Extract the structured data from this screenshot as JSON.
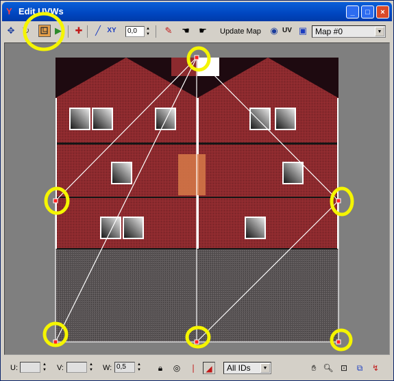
{
  "window": {
    "title": "Edit UVWs"
  },
  "title_buttons": {
    "minimize": "_",
    "maximize": "□",
    "close": "×"
  },
  "toolbar": {
    "icons": [
      "move-icon",
      "freeform-icon",
      "mirror-icon",
      "plus-icon",
      "line-icon",
      "xy-icon"
    ],
    "xy_label": "XY",
    "spinner_value": "0,0",
    "update_map_label": "Update Map",
    "uv_label": "UV",
    "map_select": "Map #0"
  },
  "bottom": {
    "u_label": "U:",
    "u_value": "",
    "v_label": "V:",
    "v_value": "",
    "w_label": "W:",
    "w_value": "0,5",
    "ids_select": "All IDs"
  },
  "colors": {
    "brick": "#8c2a2e",
    "roof_dark": "#1e0a10",
    "foundation": "#5a5556",
    "door": "#d67a48",
    "highlight": "#f5f500",
    "viewport_bg": "#7f7f7f"
  }
}
